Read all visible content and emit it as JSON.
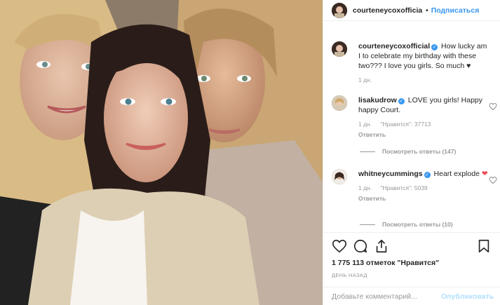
{
  "post": {
    "author": "courteneycoxofficial",
    "follow_label": "Подписаться",
    "separator": "•",
    "caption": {
      "username": "courteneycoxofficial",
      "text": "How lucky am I to celebrate my birthday with these two??? I love you girls. So much ♥",
      "time": "1 дн."
    }
  },
  "comments": [
    {
      "username": "lisakudrow",
      "text": "LOVE you girls! Happy happy Court.",
      "time": "1 дн.",
      "likes": "\"Нравится\": 37713",
      "reply_label": "Ответить",
      "view_replies": "Посмотреть ответы (147)"
    },
    {
      "username": "whitneycummings",
      "text": "Heart explode",
      "emoji": "❤",
      "time": "1 дн.",
      "likes": "\"Нравится\": 5039",
      "reply_label": "Ответить",
      "view_replies": "Посмотреть ответы (10)"
    }
  ],
  "footer": {
    "likes_count": "1 775 113 отметок \"Нравится\"",
    "timestamp": "ДЕНЬ НАЗАД",
    "comment_placeholder": "Добавьте комментарий...",
    "publish_label": "Опубликовать"
  },
  "icons": {
    "like": "heart-icon",
    "comment": "comment-icon",
    "share": "share-icon",
    "save": "bookmark-icon",
    "verified": "verified-badge-icon"
  },
  "colors": {
    "link": "#3897f0",
    "muted": "#999999",
    "publish_disabled": "#b2dffc",
    "red_heart": "#ed4956"
  }
}
